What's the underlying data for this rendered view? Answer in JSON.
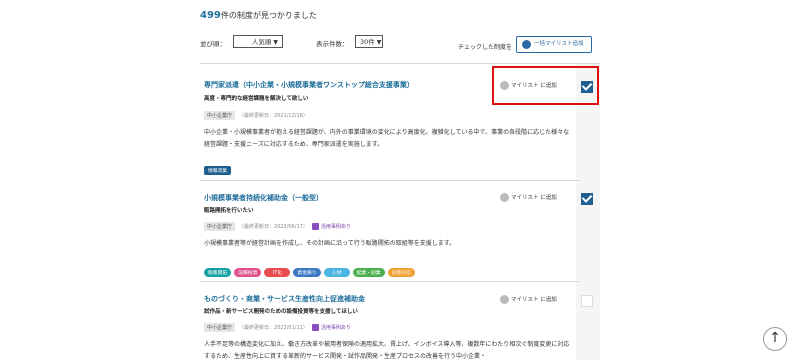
{
  "results": {
    "count": "499",
    "suffix": "件の制度が見つかりました"
  },
  "controls": {
    "sort_label": "並び順：",
    "sort_value": "人気順",
    "per_page_label": "表示件数：",
    "per_page_value": "30件",
    "checked_label": "チェックした制度を",
    "bulk_add_label": "一括マイリスト追加"
  },
  "mylist_add_label": "マイリスト に追加",
  "colors": {
    "link": "#1f6f9c",
    "check": "#1f5f8f",
    "highlight": "#e01010"
  },
  "items": [
    {
      "title": "専門家派遣（中小企業・小規模事業者ワンストップ総合支援事業）",
      "subtitle": "高度・専門的な経営課題を解決して欲しい",
      "agency": "中小企業庁",
      "updated": "（最終更新日：2021/12/16）",
      "example": "",
      "desc": "中小企業・小規模事業者が抱える経営課題が、内外の事業環境の変化により高度化、複雑化している中で、事業の各段階に応じた様々な経営課題・支援ニーズに対応するため、専門家派遣を実施します。",
      "tags": [
        {
          "label": "情報収集",
          "color": "#1f5f8f"
        }
      ],
      "checked": true
    },
    {
      "title": "小規模事業者持続化補助金（一般型）",
      "subtitle": "販路開拓を行いたい",
      "agency": "中小企業庁",
      "updated": "（最終更新日：2022/06/17）",
      "example": "活用事例あり",
      "desc": "小規模事業者等が経営計画を作成し、その計画に沿って行う販路開拓の取組等を支援します。",
      "tags": [
        {
          "label": "販路開拓",
          "color": "#17a2a2"
        },
        {
          "label": "設備投資",
          "color": "#e0508a"
        },
        {
          "label": "IT化",
          "color": "#e84c4c"
        },
        {
          "label": "資金繰り",
          "color": "#3a78c4"
        },
        {
          "label": "人材",
          "color": "#4ab5e0"
        },
        {
          "label": "起業・創業",
          "color": "#4caf50"
        },
        {
          "label": "災害対応",
          "color": "#f0a030"
        }
      ],
      "checked": true
    },
    {
      "title": "ものづくり・商業・サービス生産性向上促進補助金",
      "subtitle": "試作品・新サービス開発のための設備投資等を支援してほしい",
      "agency": "中小企業庁",
      "updated": "（最終更新日：2022/01/11）",
      "example": "活用事例あり",
      "desc": "人手不足等の構造変化に加え、働き方改革や被用者保険の適用拡大、賃上げ、インボイス導入等、複数年にわたり相次ぐ制度変更に対応するため、生産性向上に資する革新的サービス開発・試作品開発・生産プロセスの改善を行う中小企業・",
      "tags": [],
      "checked": false
    }
  ]
}
